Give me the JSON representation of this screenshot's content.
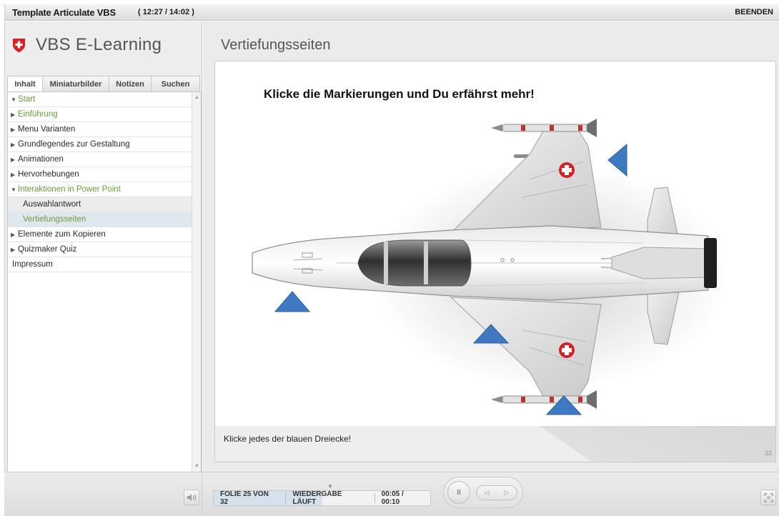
{
  "window": {
    "title": "Template Articulate VBS",
    "time": "( 12:27 / 14:02 )",
    "exit_label": "BEENDEN"
  },
  "sidebar": {
    "logo_text": "VBS E-Learning",
    "tabs": [
      "Inhalt",
      "Miniaturbilder",
      "Notizen",
      "Suchen"
    ],
    "active_tab": "Inhalt",
    "items": [
      {
        "label": "Start",
        "state": "expanded",
        "color": "green"
      },
      {
        "label": "Einführung",
        "state": "collapsed",
        "color": "green"
      },
      {
        "label": "Menu Varianten",
        "state": "collapsed"
      },
      {
        "label": "Grundlegendes zur Gestaltung",
        "state": "collapsed"
      },
      {
        "label": "Animationen",
        "state": "collapsed"
      },
      {
        "label": "Hervorhebungen",
        "state": "collapsed"
      },
      {
        "label": "Interaktionen in Power Point",
        "state": "expanded",
        "color": "green"
      },
      {
        "label": "Auswahlantwort",
        "level": 2
      },
      {
        "label": "Vertiefungsseiten",
        "level": 2,
        "current": true
      },
      {
        "label": "Elemente zum Kopieren",
        "state": "collapsed"
      },
      {
        "label": "Quizmaker Quiz",
        "state": "collapsed"
      },
      {
        "label": "Impressum"
      }
    ]
  },
  "main": {
    "heading": "Vertiefungsseiten",
    "slide_heading": "Klicke die Markierungen und Du erfährst mehr!",
    "slide_caption": "Klicke jedes der blauen Dreiecke!",
    "slide_number": "33",
    "marker_color": "#3f79c2"
  },
  "player": {
    "slide_status": "FOLIE 25 VON 32",
    "playback_status": "WIEDERGABE LÄUFT",
    "time": "00:05 / 00:10",
    "progress": 0.5,
    "pause_label": "II",
    "prev_label": "◁",
    "next_label": "▷"
  },
  "colors": {
    "accent_green": "#6b9a3a",
    "swiss_red": "#d42027",
    "marker_blue": "#3f79c2"
  }
}
